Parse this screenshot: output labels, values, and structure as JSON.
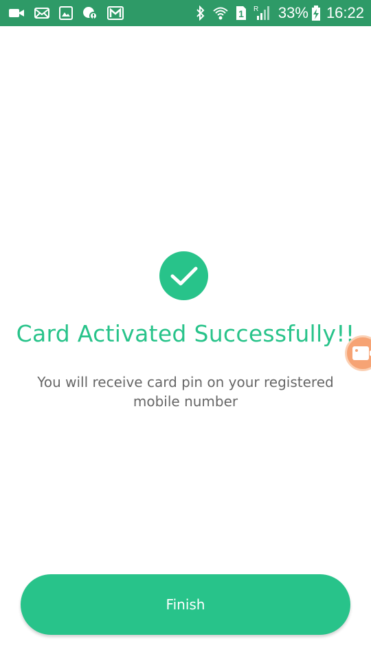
{
  "status_bar": {
    "battery_percent": "33%",
    "time": "16:22",
    "sim_slot": "1",
    "roaming_indicator": "R",
    "left_icons": [
      "video-icon",
      "mail-icon",
      "gallery-icon",
      "chat-icon",
      "gmail-icon"
    ],
    "right_icons": [
      "bluetooth-icon",
      "wifi-icon",
      "sim-icon",
      "signal-icon",
      "battery-charging-icon"
    ]
  },
  "confirmation": {
    "icon": "checkmark-icon",
    "title": "Card Activated Successfully!!",
    "message": "You will receive card pin on your registered mobile number"
  },
  "floating_button": {
    "icon": "video-camera-icon"
  },
  "actions": {
    "finish_label": "Finish"
  },
  "colors": {
    "status_bar": "#2e9a67",
    "accent": "#28c38a",
    "body_text": "#666666",
    "floating_bubble": "#f6a374"
  }
}
